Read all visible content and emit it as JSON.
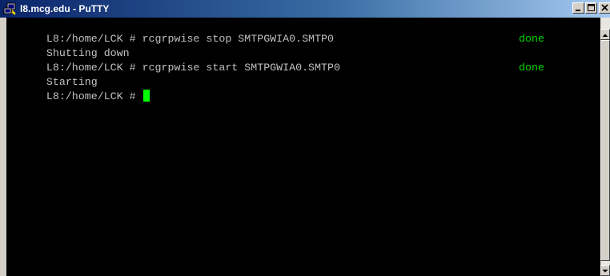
{
  "window": {
    "title": "l8.mcg.edu - PuTTY",
    "app_icon": "putty-terminal-icon",
    "controls": {
      "minimize_icon": "minimize-icon",
      "maximize_icon": "maximize-icon",
      "close_icon": "close-icon"
    }
  },
  "terminal": {
    "lines": [
      {
        "text": "L8:/home/LCK # rcgrpwise stop SMTPGWIA0.SMTP0",
        "status": ""
      },
      {
        "text": "Shutting down",
        "status": "done"
      },
      {
        "text": "L8:/home/LCK # rcgrpwise start SMTPGWIA0.SMTP0",
        "status": ""
      },
      {
        "text": "Starting",
        "status": "done"
      },
      {
        "text": "L8:/home/LCK # ",
        "status": ""
      }
    ]
  },
  "colors": {
    "title_bar_start": "#0a246a",
    "title_bar_end": "#a6caf0",
    "terminal_background": "#000000",
    "terminal_text": "#c0c0c0",
    "status_text": "#00d800",
    "cursor": "#00ff00"
  }
}
